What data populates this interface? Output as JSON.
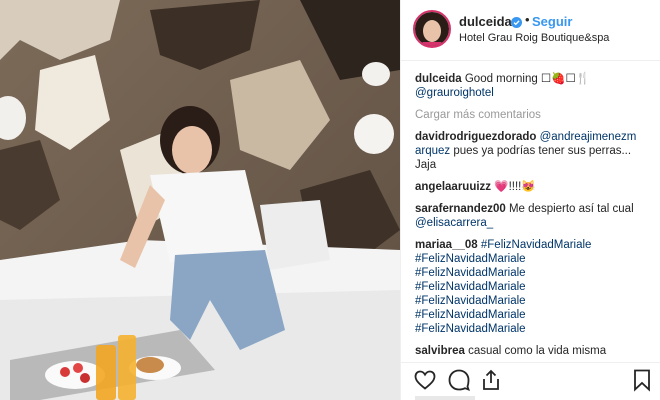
{
  "post": {
    "username": "dulceida",
    "follow_label": "Seguir",
    "separator": "•",
    "location": "Hotel Grau Roig Boutique&spa"
  },
  "caption": {
    "username": "dulceida",
    "text": "Good morning ☐🍓☐🍴",
    "mention": "@grauroighotel"
  },
  "load_more": "Cargar más comentarios",
  "comments": [
    {
      "username": "davidrodriguezdorado",
      "mention": "@andreajimenezm arquez",
      "text": " pues ya podrías tener sus perras... Jaja"
    },
    {
      "username": "angelaaruuizz",
      "text": "💗!!!!😻"
    },
    {
      "username": "sarafernandez00",
      "text": " Me despierto así tal cual ",
      "mention": "@elisacarrera_"
    },
    {
      "username": "mariaa__08",
      "tags": [
        "#FelizNavidadMariale",
        "#FelizNavidadMariale",
        "#FelizNavidadMariale",
        "#FelizNavidadMariale",
        "#FelizNavidadMariale",
        "#FelizNavidadMariale",
        "#FelizNavidadMariale"
      ]
    },
    {
      "username": "salvibrea",
      "text": " casual como la vida misma"
    }
  ],
  "icons": [
    "heart-icon",
    "comment-icon",
    "share-icon",
    "bookmark-icon",
    "verified-badge-icon"
  ],
  "colors": {
    "link": "#003569",
    "follow": "#3897f0",
    "muted": "#999999",
    "text": "#262626"
  }
}
